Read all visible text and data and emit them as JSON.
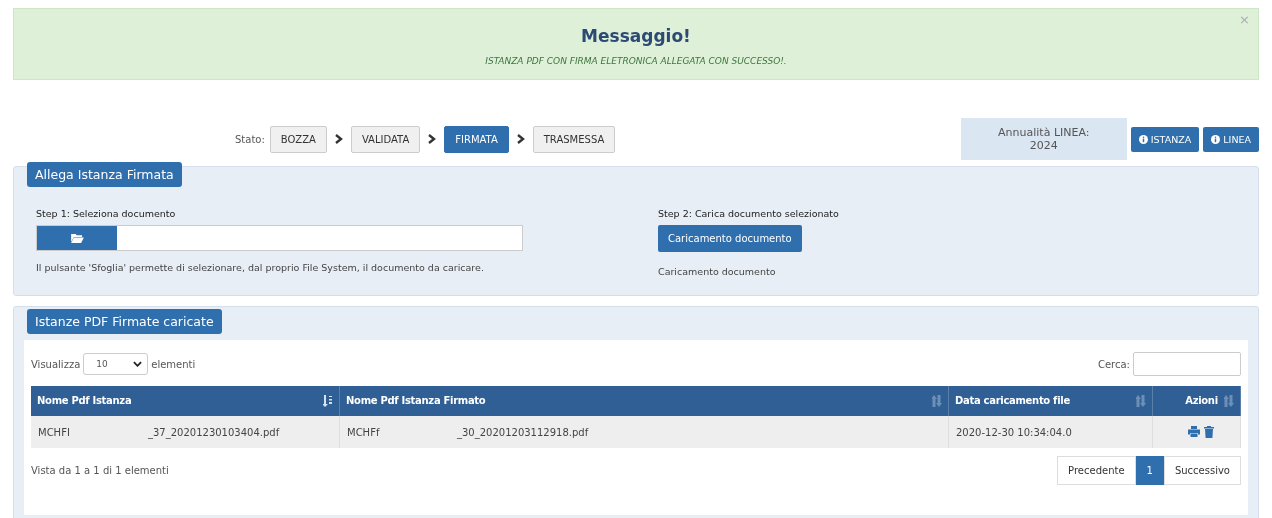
{
  "alert": {
    "title": "Messaggio!",
    "message": "ISTANZA PDF CON FIRMA ELETRONICA ALLEGATA CON SUCCESSO!.",
    "close": "×"
  },
  "status": {
    "label": "Stato:",
    "steps": [
      {
        "label": "BOZZA",
        "selected": false
      },
      {
        "label": "VALIDATA",
        "selected": false
      },
      {
        "label": "FIRMATA",
        "selected": true
      },
      {
        "label": "TRASMESSA",
        "selected": false
      }
    ]
  },
  "annualita": "Annualità LINEA: 2024",
  "info_buttons": [
    "ISTANZA",
    "LINEA"
  ],
  "upload_panel": {
    "title": "Allega Istanza Firmata",
    "step1": {
      "label": "Step 1: Seleziona documento",
      "help": "Il pulsante 'Sfoglia' permette di selezionare, dal proprio File System, il documento da caricare."
    },
    "step2": {
      "label": "Step 2: Carica documento selezionato",
      "button": "Caricamento documento",
      "note": "Caricamento documento"
    }
  },
  "list_panel": {
    "title": "Istanze PDF Firmate caricate",
    "length_label": "Visualizza",
    "length_value": "10",
    "length_suffix": "elementi",
    "search_label": "Cerca:",
    "table": {
      "columns": [
        {
          "label": "Nome Pdf Istanza",
          "sorted": true
        },
        {
          "label": "Nome Pdf Istanza Firmato",
          "sorted": false
        },
        {
          "label": "Data caricamento file",
          "sorted": false
        },
        {
          "label": "Azioni",
          "sorted": false
        }
      ],
      "rows": [
        {
          "file": [
            "MCHFI",
            "_37_20201230103404.pdf"
          ],
          "signed_file": [
            "MCHFf",
            "_30_20201203112918.pdf"
          ],
          "date": "2020-12-30 10:34:04.0"
        }
      ]
    },
    "info": "Vista da 1 a 1 di 1 elementi",
    "pagination": [
      {
        "label": "Precedente",
        "selected": false
      },
      {
        "label": "1",
        "selected": true
      },
      {
        "label": "Successivo",
        "selected": false
      }
    ]
  }
}
